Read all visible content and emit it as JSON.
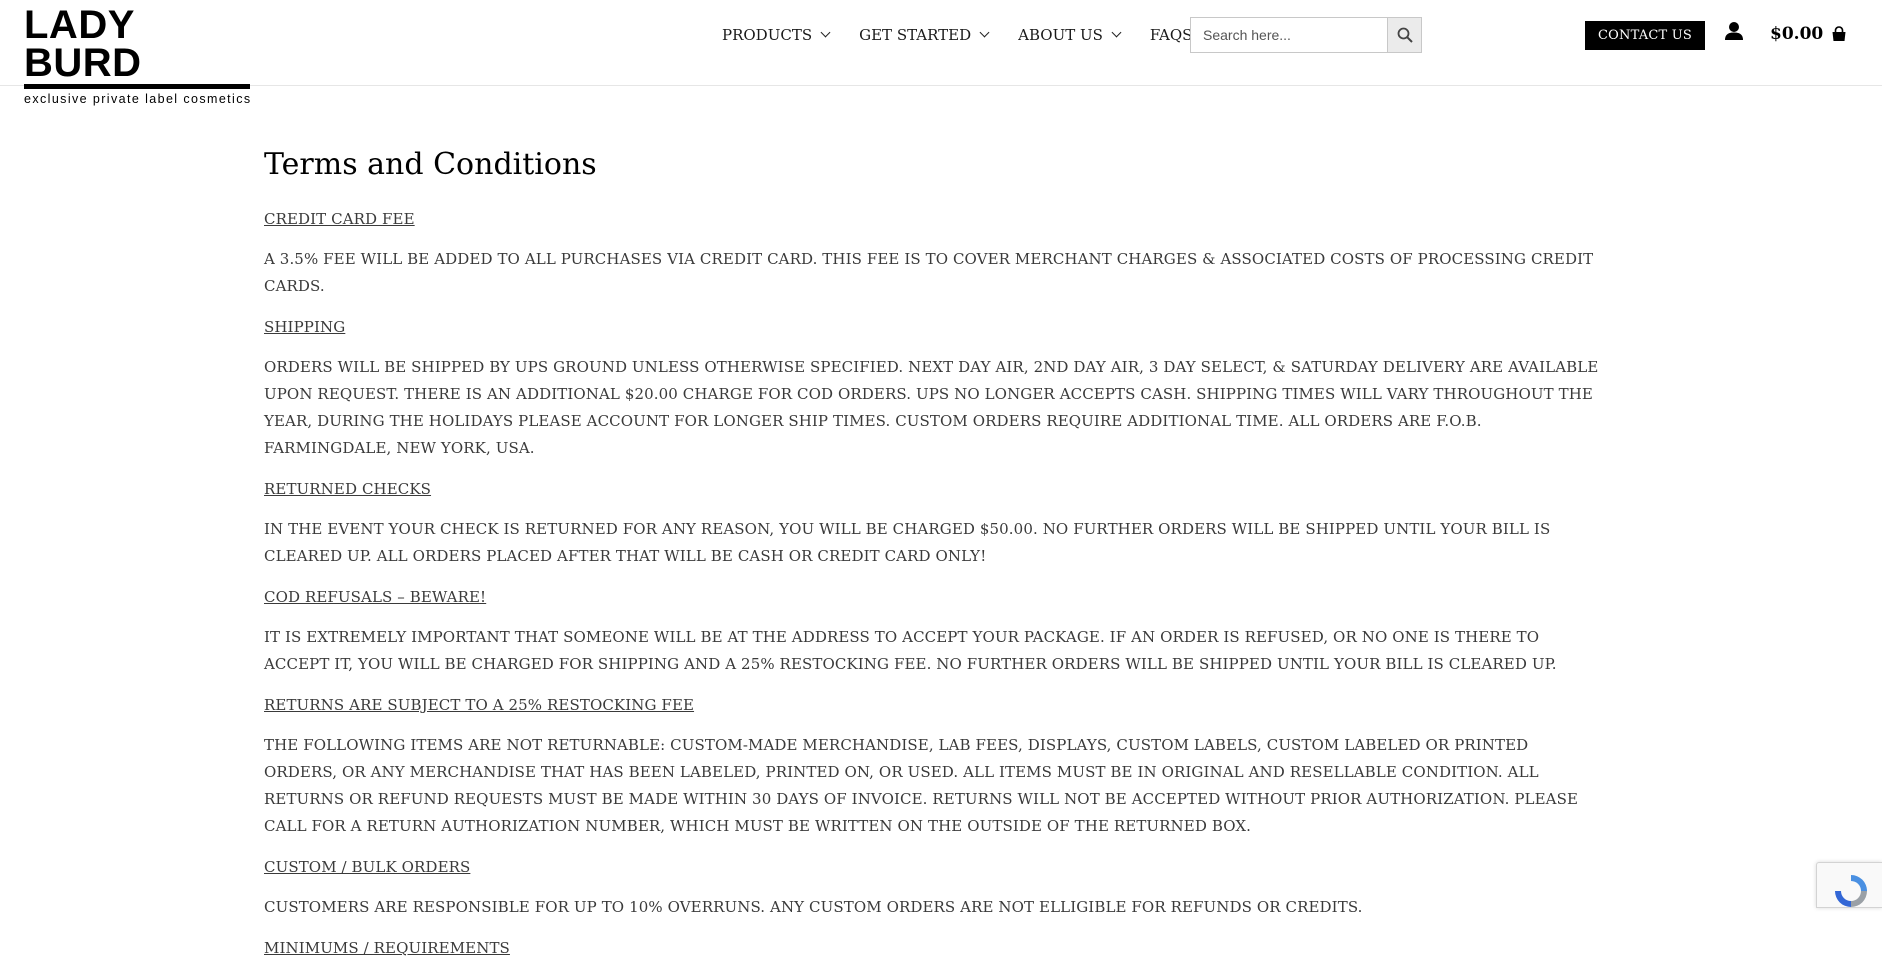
{
  "header": {
    "logo_name": "LADY BURD",
    "logo_tagline": "exclusive private label cosmetics",
    "nav": [
      {
        "label": "PRODUCTS",
        "dropdown": true
      },
      {
        "label": "GET STARTED",
        "dropdown": true
      },
      {
        "label": "ABOUT US",
        "dropdown": true
      },
      {
        "label": "FAQS",
        "dropdown": false
      }
    ],
    "search": {
      "placeholder": "Search here...",
      "icon": "search-icon"
    },
    "contact_label": "CONTACT US",
    "account_icon": "user-icon",
    "cart_total": "$0.00",
    "cart_icon": "shopping-bag-icon"
  },
  "page": {
    "title": "Terms and Conditions",
    "sections": [
      {
        "heading": "CREDIT CARD FEE",
        "body": "A 3.5% FEE WILL BE ADDED TO ALL PURCHASES VIA CREDIT CARD.  THIS FEE IS TO COVER MERCHANT CHARGES & ASSOCIATED COSTS OF PROCESSING CREDIT CARDS."
      },
      {
        "heading": "SHIPPING",
        "body": "ORDERS WILL BE SHIPPED BY UPS GROUND UNLESS OTHERWISE SPECIFIED. NEXT DAY AIR, 2ND DAY AIR, 3 DAY SELECT, & SATURDAY DELIVERY ARE AVAILABLE UPON REQUEST. THERE IS AN ADDITIONAL $20.00 CHARGE FOR COD ORDERS. UPS NO LONGER ACCEPTS CASH.  SHIPPING TIMES WILL VARY THROUGHOUT THE YEAR, DURING THE HOLIDAYS PLEASE ACCOUNT FOR LONGER SHIP TIMES. CUSTOM ORDERS REQUIRE ADDITIONAL TIME. ALL ORDERS ARE F.O.B. FARMINGDALE, NEW YORK, USA."
      },
      {
        "heading": "RETURNED CHECKS",
        "body": "IN THE EVENT YOUR CHECK IS RETURNED FOR ANY REASON, YOU WILL BE CHARGED $50.00. NO FURTHER ORDERS WILL BE SHIPPED UNTIL YOUR BILL IS CLEARED UP. ALL ORDERS PLACED AFTER THAT WILL BE CASH OR CREDIT CARD ONLY!"
      },
      {
        "heading": "COD REFUSALS – BEWARE!",
        "body": "IT IS EXTREMELY IMPORTANT THAT SOMEONE WILL BE AT THE ADDRESS TO ACCEPT YOUR PACKAGE. IF AN ORDER IS REFUSED, OR NO ONE IS THERE TO ACCEPT IT, YOU WILL BE CHARGED FOR SHIPPING AND A 25% RESTOCKING FEE. NO FURTHER ORDERS WILL BE SHIPPED UNTIL YOUR BILL IS CLEARED UP."
      },
      {
        "heading": "RETURNS ARE SUBJECT TO A 25% RESTOCKING FEE",
        "body": "THE FOLLOWING ITEMS ARE NOT RETURNABLE: CUSTOM-MADE MERCHANDISE, LAB FEES, DISPLAYS, CUSTOM LABELS, CUSTOM LABELED OR PRINTED ORDERS, OR ANY MERCHANDISE THAT HAS BEEN LABELED, PRINTED ON, OR USED.  ALL ITEMS MUST BE IN ORIGINAL AND RESELLABLE CONDITION.  ALL RETURNS OR REFUND REQUESTS MUST BE MADE WITHIN 30 DAYS OF INVOICE.  RETURNS WILL NOT BE ACCEPTED WITHOUT PRIOR AUTHORIZATION.  PLEASE CALL FOR A RETURN AUTHORIZATION NUMBER, WHICH MUST BE WRITTEN ON THE OUTSIDE OF THE RETURNED BOX."
      },
      {
        "heading": "CUSTOM / BULK ORDERS",
        "body": "CUSTOMERS ARE RESPONSIBLE FOR UP TO 10% OVERRUNS. ANY CUSTOM ORDERS ARE NOT ELLIGIBLE FOR REFUNDS OR CREDITS."
      },
      {
        "heading": "MINIMUMS / REQUIREMENTS",
        "body": ""
      }
    ]
  }
}
